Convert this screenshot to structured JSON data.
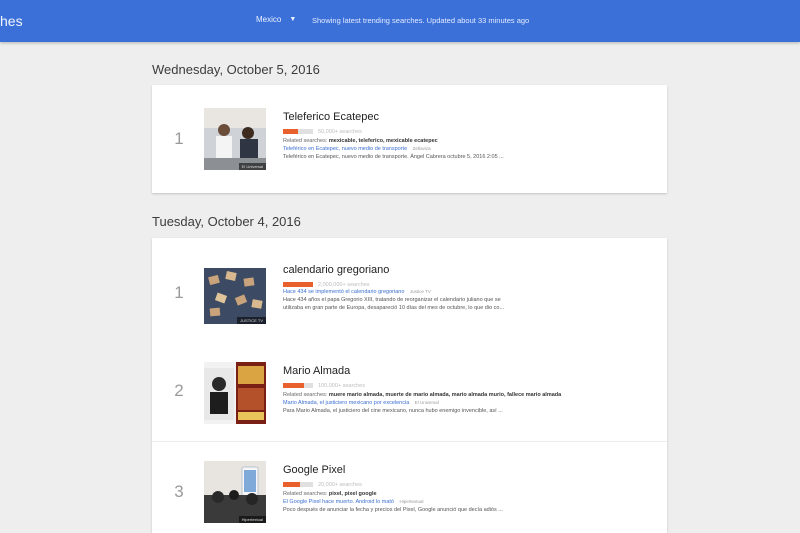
{
  "header": {
    "app_title": "hes",
    "region": "Mexico",
    "status": "Showing latest trending searches. Updated about 33 minutes ago"
  },
  "sections": [
    {
      "date": "Wednesday, October 5, 2016",
      "items": [
        {
          "rank": "1",
          "title": "Teleferico Ecatepec",
          "volume": "50,000+ searches",
          "volume_fraction": 0.5,
          "related_label": "Related searches:",
          "related": "mexicable, teleferico, mexicable ecatepec",
          "article_title": "Teleférico en Ecatepec, nuevo medio de transporte",
          "source": "Zetlaviza",
          "snippet": "Teleférico en Ecatepec, nuevo medio de transporte. Ángel Cabrera octubre 5, 2016 2:05 ...",
          "image_credit": "El Universal",
          "thumb_colors": [
            "#8a6f5e",
            "#f4f1ee"
          ]
        }
      ]
    },
    {
      "date": "Tuesday, October 4, 2016",
      "items": [
        {
          "rank": "1",
          "title": "calendario gregoriano",
          "volume": "2,000,000+ searches",
          "volume_fraction": 1.0,
          "related_label": "",
          "related": "",
          "article_title": "Hace 434 se implementó el calendario gregoriano",
          "source": "Justice TV",
          "snippet": "Hace 434 años el papa Gregorio XIII, tratando de reorganizar el calendario juliano que se",
          "snippet2": "utilizaba en gran parte de Europa, desapareció 10 días del mes de octubre, lo que dio co...",
          "image_credit": "JUSTICE TV",
          "thumb_colors": [
            "#3a4a66",
            "#c9a37b"
          ]
        },
        {
          "rank": "2",
          "title": "Mario Almada",
          "volume": "100,000+ searches",
          "volume_fraction": 0.7,
          "related_label": "Related searches:",
          "related": "muere mario almada, muerte de mario almada, mario almada murio, fallece mario almada",
          "article_title": "Mario Almada, el justiciero mexicano por excelencia",
          "source": "El Universal",
          "snippet": "Para Mario Almada, el justiciero del cine mexicano, nunca hubo enemigo invencible, así ...",
          "image_credit": "El Universal",
          "thumb_colors": [
            "#7a1f14",
            "#d9a441"
          ]
        },
        {
          "rank": "3",
          "title": "Google Pixel",
          "volume": "20,000+ searches",
          "volume_fraction": 0.55,
          "related_label": "Related searches:",
          "related": "pixel, pixel google",
          "article_title": "El Google Pixel hace muerto. Android lo mató",
          "source": "Hipertextual",
          "snippet": "Poco después de anunciar la fecha y precios del Pixel, Google anunció que decía adiós ...",
          "image_credit": "Hipertextual",
          "thumb_colors": [
            "#2c2c2c",
            "#e8e4df"
          ]
        }
      ]
    }
  ]
}
